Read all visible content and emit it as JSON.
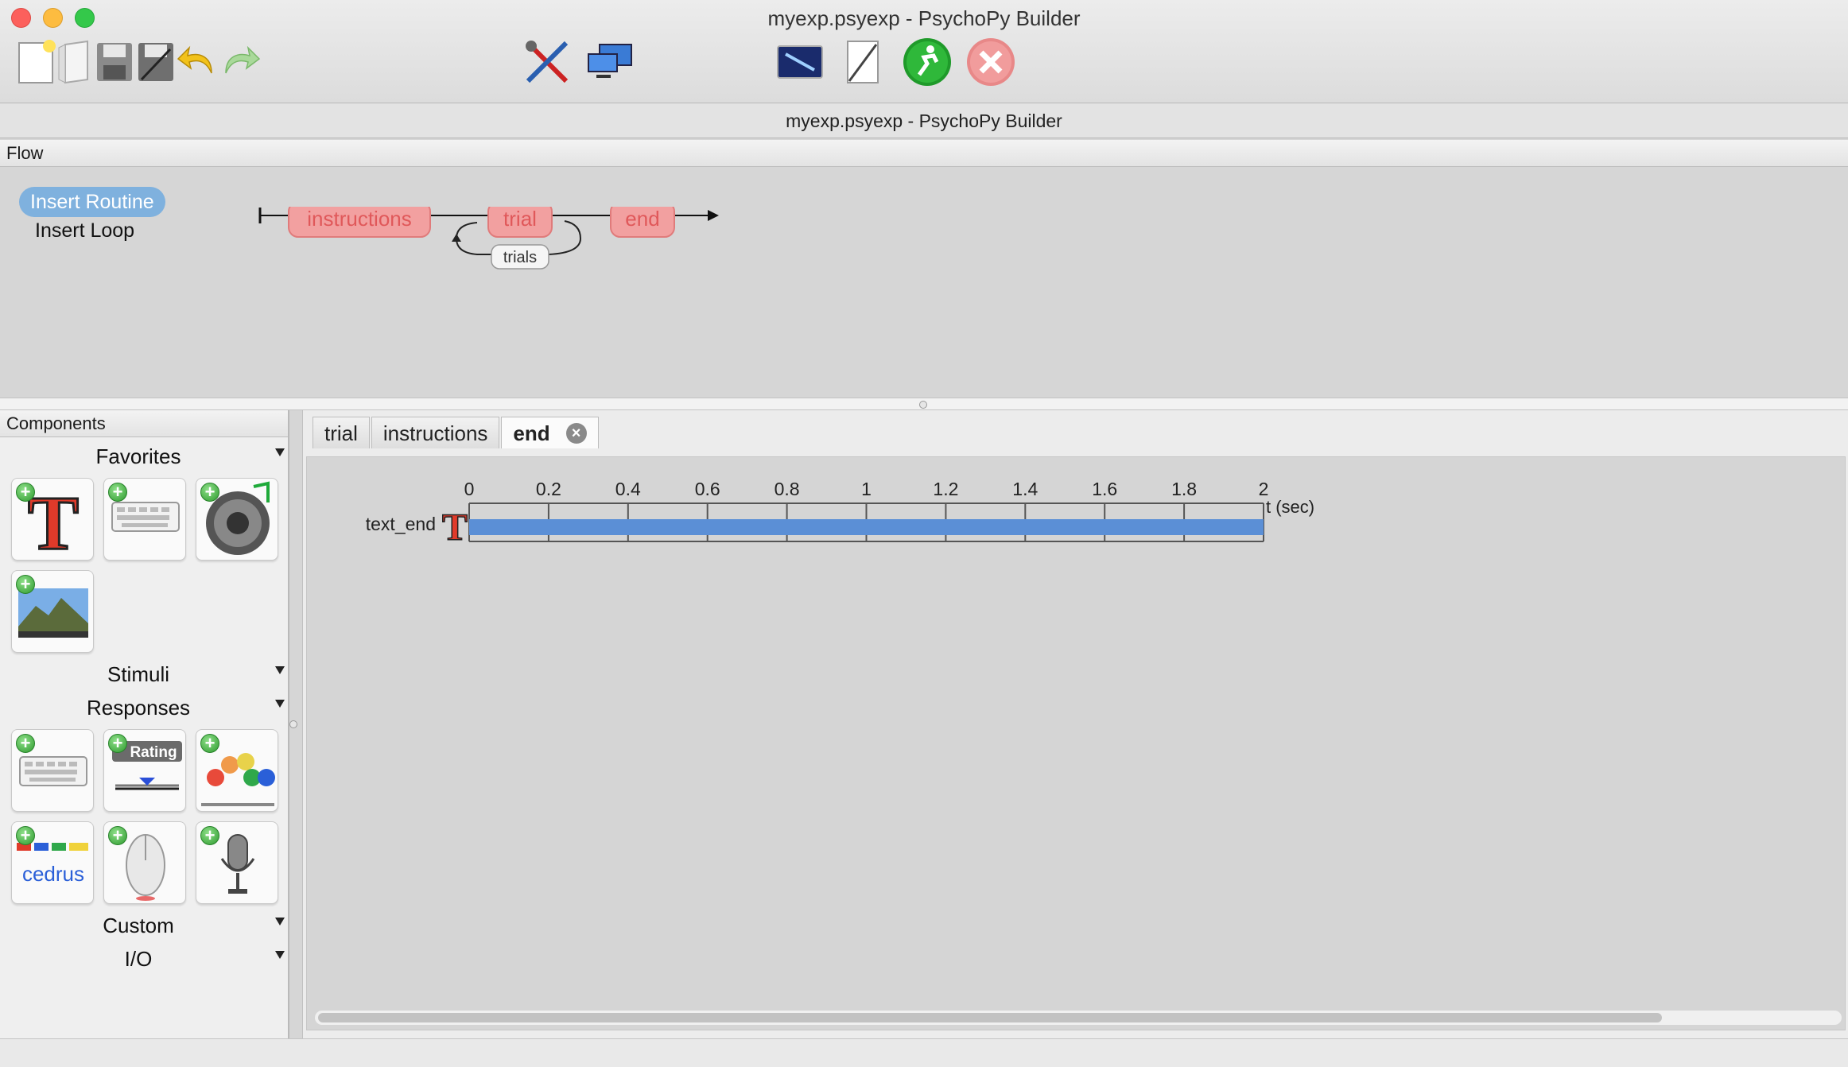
{
  "window": {
    "title": "myexp.psyexp - PsychoPy Builder",
    "subtitle": "myexp.psyexp - PsychoPy Builder"
  },
  "toolbar": {
    "items": [
      {
        "name": "new-icon",
        "interactable": true
      },
      {
        "name": "open-icon",
        "interactable": true
      },
      {
        "name": "save-icon",
        "interactable": true
      },
      {
        "name": "save-as-icon",
        "interactable": true
      },
      {
        "name": "undo-icon",
        "interactable": true
      },
      {
        "name": "redo-icon",
        "interactable": true
      },
      {
        "name": "preferences-icon",
        "interactable": true
      },
      {
        "name": "monitor-center-icon",
        "interactable": true
      },
      {
        "name": "experiment-settings-icon",
        "interactable": true
      },
      {
        "name": "compile-script-icon",
        "interactable": true
      },
      {
        "name": "run-icon",
        "interactable": true
      },
      {
        "name": "stop-icon",
        "interactable": false
      }
    ]
  },
  "flow": {
    "header": "Flow",
    "insert_routine": "Insert Routine",
    "insert_loop": "Insert Loop",
    "routines": [
      "instructions",
      "trial",
      "end"
    ],
    "loop_label": "trials",
    "routine_color": "#f2a0a0",
    "routine_text_color": "#e0585a"
  },
  "components": {
    "header": "Components",
    "categories": {
      "favorites": "Favorites",
      "stimuli": "Stimuli",
      "responses": "Responses",
      "custom": "Custom",
      "io": "I/O"
    },
    "favorites_items": [
      "text-component-icon",
      "keyboard-component-icon",
      "sound-component-icon",
      "image-component-icon"
    ],
    "responses_items": [
      "keyboard-component-icon",
      "rating-scale-component-icon",
      "joystick-buttons-component-icon",
      "cedrus-component-icon",
      "mouse-component-icon",
      "microphone-component-icon"
    ],
    "rating_label": "Rating",
    "cedrus_label": "cedrus"
  },
  "routine_tabs": {
    "tabs": [
      "trial",
      "instructions",
      "end"
    ],
    "active": "end"
  },
  "timeline": {
    "ticks": [
      "0",
      "0.2",
      "0.4",
      "0.6",
      "0.8",
      "1",
      "1.2",
      "1.4",
      "1.6",
      "1.8",
      "2"
    ],
    "axis_label": "t (sec)",
    "components": [
      {
        "name": "text_end",
        "start": 0,
        "stop": 2,
        "color": "#5b8fd6"
      }
    ]
  }
}
